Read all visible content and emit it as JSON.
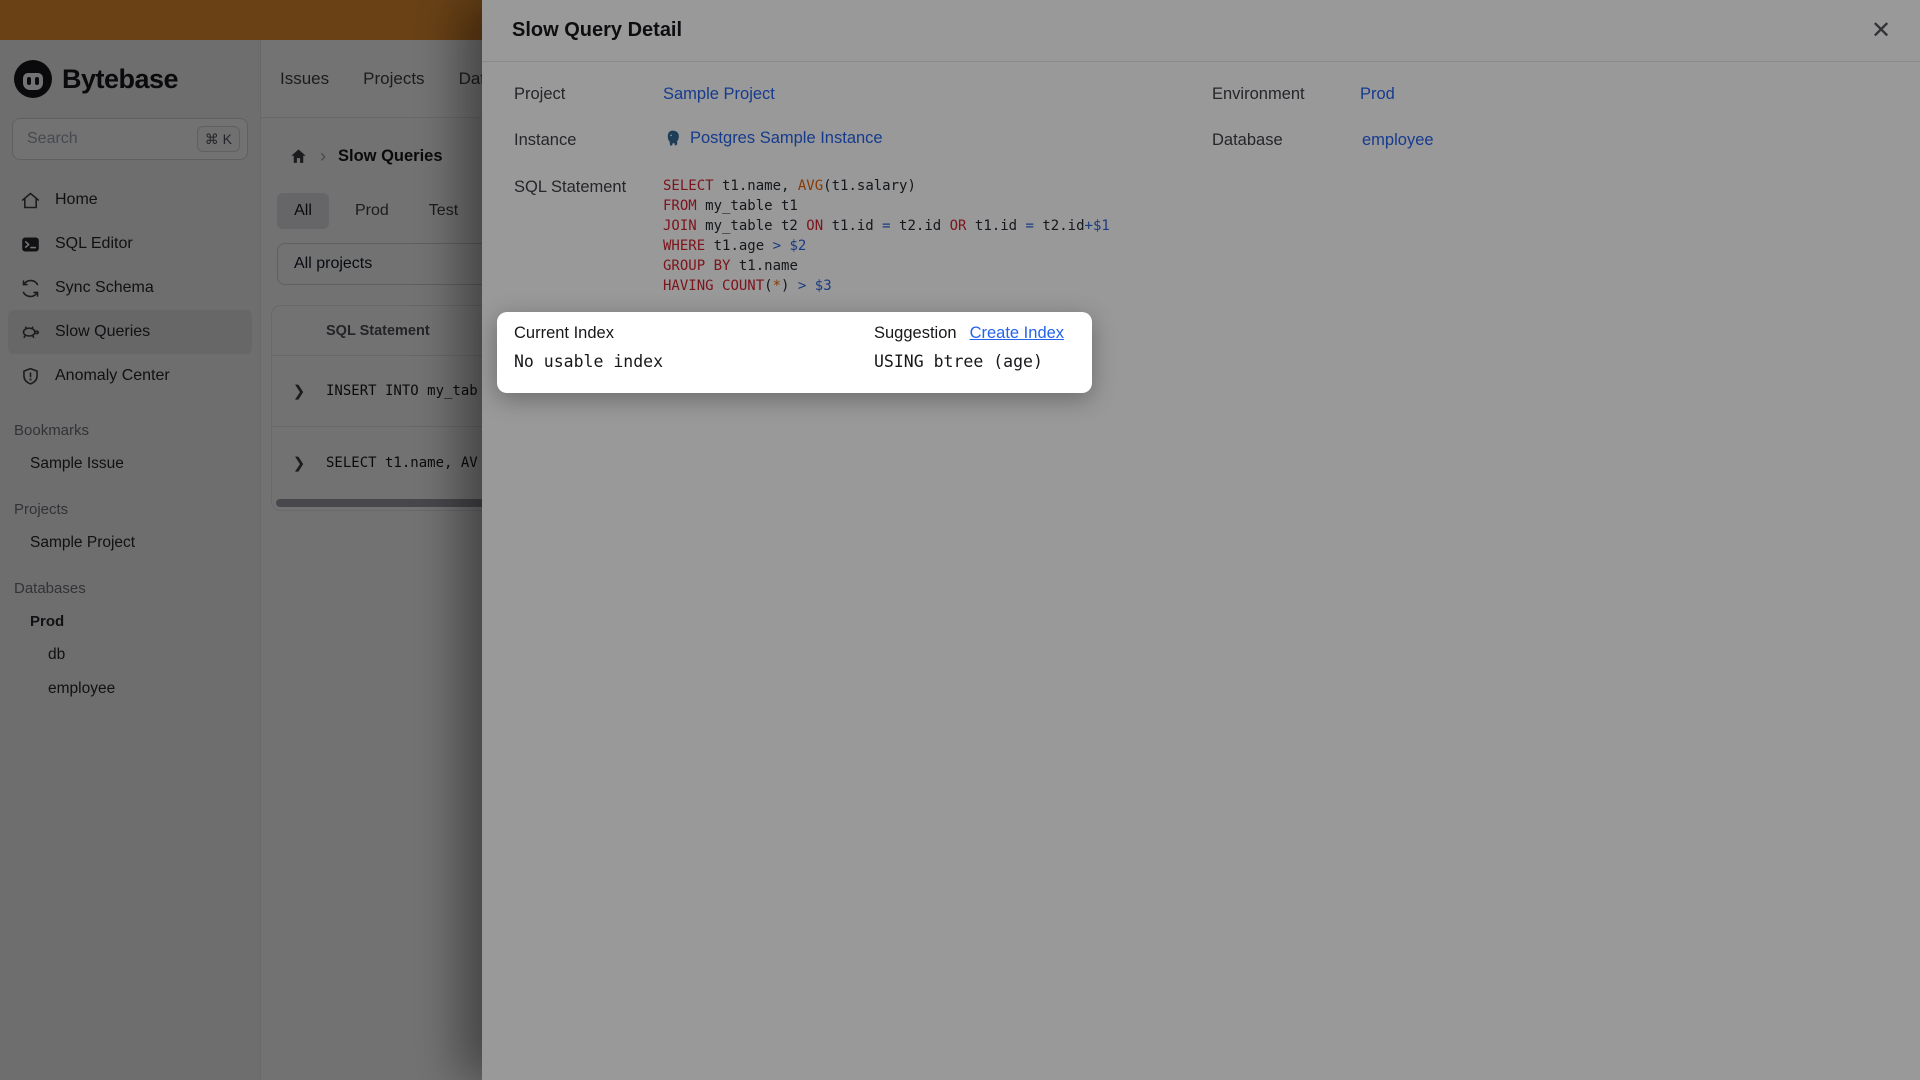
{
  "colors": {
    "banner": "#e89030",
    "accent_link": "#2563eb",
    "postgres_blue": "#336791",
    "tokens": {
      "kw": "#cf222e",
      "fn": "#e36209",
      "op": "#2e63d6",
      "tx": "#24292f"
    }
  },
  "brand": {
    "name": "Bytebase"
  },
  "search": {
    "placeholder": "Search",
    "shortcut": "⌘ K"
  },
  "nav": {
    "items": [
      "Issues",
      "Projects",
      "Databases"
    ]
  },
  "sidebar": {
    "menu": [
      {
        "label": "Home",
        "icon": "home-icon",
        "active": false
      },
      {
        "label": "SQL Editor",
        "icon": "terminal-icon",
        "active": false
      },
      {
        "label": "Sync Schema",
        "icon": "sync-icon",
        "active": false
      },
      {
        "label": "Slow Queries",
        "icon": "turtle-icon",
        "active": true
      },
      {
        "label": "Anomaly Center",
        "icon": "shield-icon",
        "active": false
      }
    ],
    "sections": [
      {
        "title": "Bookmarks",
        "items": [
          {
            "label": "Sample Issue",
            "level": 1,
            "bold": false
          }
        ]
      },
      {
        "title": "Projects",
        "items": [
          {
            "label": "Sample Project",
            "level": 1,
            "bold": false
          }
        ]
      },
      {
        "title": "Databases",
        "items": [
          {
            "label": "Prod",
            "level": 1,
            "bold": true
          },
          {
            "label": "db",
            "level": 2,
            "bold": false
          },
          {
            "label": "employee",
            "level": 2,
            "bold": false
          }
        ]
      }
    ]
  },
  "breadcrumb": {
    "current": "Slow Queries"
  },
  "env_tabs": [
    {
      "label": "All",
      "active": true
    },
    {
      "label": "Prod",
      "active": false
    },
    {
      "label": "Test",
      "active": false
    }
  ],
  "project_filter": {
    "value": "All projects"
  },
  "query_table": {
    "columns": [
      "SQL Statement"
    ],
    "rows": [
      {
        "sql": "INSERT INTO my_tab"
      },
      {
        "sql": "SELECT t1.name, AV"
      }
    ]
  },
  "modal": {
    "title": "Slow Query Detail",
    "close_glyph": "✕",
    "fields": {
      "project_label": "Project",
      "project_value": "Sample Project",
      "environment_label": "Environment",
      "environment_value": "Prod",
      "instance_label": "Instance",
      "instance_value": "Postgres Sample Instance",
      "database_label": "Database",
      "database_value": "employee",
      "sql_label": "SQL Statement"
    },
    "sql_lines": [
      [
        {
          "c": "kw",
          "t": "SELECT"
        },
        {
          "c": "tx",
          "t": " t1.name, "
        },
        {
          "c": "fn",
          "t": "AVG"
        },
        {
          "c": "tx",
          "t": "(t1.salary)"
        }
      ],
      [
        {
          "c": "kw",
          "t": "FROM"
        },
        {
          "c": "tx",
          "t": " my_table t1"
        }
      ],
      [
        {
          "c": "kw",
          "t": "JOIN"
        },
        {
          "c": "tx",
          "t": " my_table t2 "
        },
        {
          "c": "kw",
          "t": "ON"
        },
        {
          "c": "tx",
          "t": " t1.id "
        },
        {
          "c": "op",
          "t": "="
        },
        {
          "c": "tx",
          "t": " t2.id "
        },
        {
          "c": "kw",
          "t": "OR"
        },
        {
          "c": "tx",
          "t": " t1.id "
        },
        {
          "c": "op",
          "t": "="
        },
        {
          "c": "tx",
          "t": " t2.id"
        },
        {
          "c": "op",
          "t": "+$1"
        }
      ],
      [
        {
          "c": "kw",
          "t": "WHERE"
        },
        {
          "c": "tx",
          "t": " t1.age "
        },
        {
          "c": "op",
          "t": "> $2"
        }
      ],
      [
        {
          "c": "kw",
          "t": "GROUP BY"
        },
        {
          "c": "tx",
          "t": " t1.name"
        }
      ],
      [
        {
          "c": "kw",
          "t": "HAVING"
        },
        {
          "c": "tx",
          "t": " "
        },
        {
          "c": "kw",
          "t": "COUNT"
        },
        {
          "c": "tx",
          "t": "("
        },
        {
          "c": "fn",
          "t": "*"
        },
        {
          "c": "tx",
          "t": ") "
        },
        {
          "c": "op",
          "t": "> $3"
        }
      ]
    ]
  },
  "suggestion_card": {
    "current_index_label": "Current Index",
    "current_index_value": "No usable index",
    "suggestion_label": "Suggestion",
    "action_label": "Create Index",
    "suggestion_value": "USING btree (age)"
  }
}
